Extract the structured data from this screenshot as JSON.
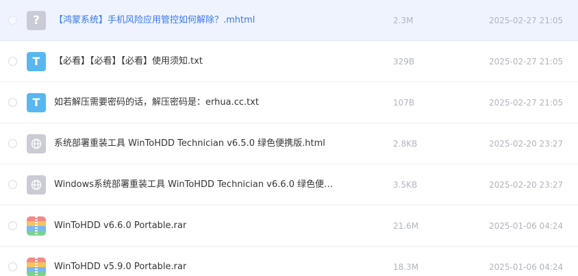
{
  "files": [
    {
      "name": "【鸿蒙系统】手机风险应用管控如何解除？.mhtml",
      "size": "2.3M",
      "date": "2025-02-27 21:05",
      "icon": "unknown-file-icon",
      "icon_glyph": "?"
    },
    {
      "name": "【必看】【必看】【必看】使用须知.txt",
      "size": "329B",
      "date": "2025-02-27 21:05",
      "icon": "text-file-icon",
      "icon_glyph": "T"
    },
    {
      "name": "如若解压需要密码的话，解压密码是：erhua.cc.txt",
      "size": "107B",
      "date": "2025-02-27 21:05",
      "icon": "text-file-icon",
      "icon_glyph": "T"
    },
    {
      "name": "系统部署重装工具 WinToHDD Technician v6.5.0 绿色便携版.html",
      "size": "2.8KB",
      "date": "2025-02-20 23:27",
      "icon": "web-file-icon"
    },
    {
      "name": "Windows系统部署重装工具 WinToHDD Technician v6.6.0 绿色便携…",
      "size": "3.5KB",
      "date": "2025-02-20 23:27",
      "icon": "web-file-icon"
    },
    {
      "name": "WinToHDD v6.6.0 Portable.rar",
      "size": "21.6M",
      "date": "2025-01-06 04:24",
      "icon": "archive-file-icon"
    },
    {
      "name": "WinToHDD v5.9.0 Portable.rar",
      "size": "18.3M",
      "date": "2025-01-06 04:24",
      "icon": "archive-file-icon"
    }
  ],
  "colors": {
    "hover_row_bg": "#eef3fe",
    "link_blue": "#3a78e6",
    "text": "#333333",
    "meta_text": "#b0b4bd",
    "txt_icon": "#58b7f0",
    "neutral_icon": "#c9ccd4"
  }
}
